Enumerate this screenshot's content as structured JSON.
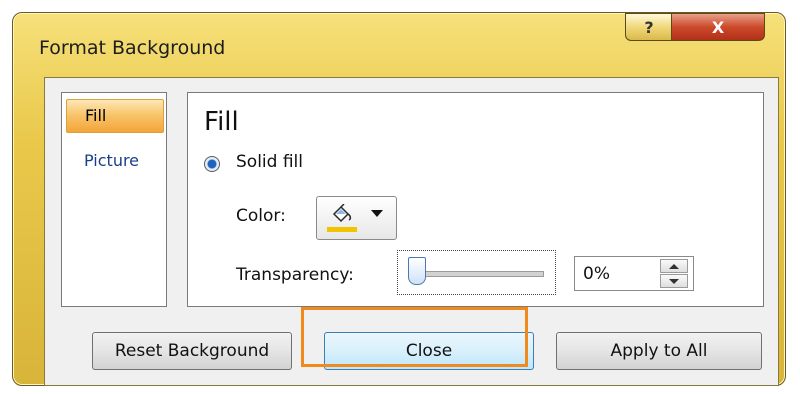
{
  "dialog": {
    "title": "Format Background",
    "help_glyph": "?",
    "close_glyph": "X"
  },
  "nav": {
    "items": [
      {
        "label": "Fill",
        "selected": true
      },
      {
        "label": "Picture",
        "selected": false
      }
    ]
  },
  "panel": {
    "title": "Fill",
    "solid_fill_label": "Solid fill",
    "color_label": "Color:",
    "color_swatch": "#f2c300",
    "transparency_label": "Transparency:",
    "transparency_value": "0%",
    "transparency_level": 0
  },
  "buttons": {
    "reset": "Reset Background",
    "close": "Close",
    "apply_all": "Apply to All"
  },
  "colors": {
    "highlight": "#f28a1b"
  }
}
